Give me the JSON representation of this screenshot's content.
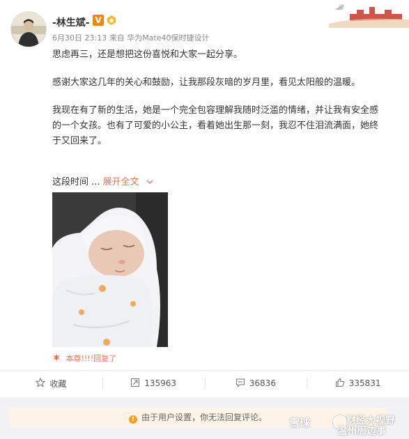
{
  "post": {
    "username": "-林生斌-",
    "vip_badge": "V",
    "timestamp": "6月30日 23:13",
    "source_prefix": "来自",
    "source": "华为Mate40保时捷设计",
    "paragraphs": [
      "思虑再三，还是想把这份喜悦和大家一起分享。",
      "感谢大家这几年的关心和鼓励，让我那段灰暗的岁月里，看见太阳般的温暖。",
      "我现在有了新的生活，她是一个完全包容理解我随时泛滥的情绪，并让我有安全感的一个女孩。也有了可爱的小公主，看着她出生那一刻，我忍不住泪流满面，她终于又回来了。"
    ],
    "truncated_text": "这段时间 ...",
    "expand_label": "展开全文",
    "reply_line": "本尊!!!!回复了"
  },
  "actions": {
    "favorite_label": "收藏",
    "repost_count": "135963",
    "comment_count": "36836",
    "like_count": "335831"
  },
  "notice": {
    "text": "由于用户设置，你无法回复评论。"
  },
  "watermarks": {
    "left": "雪球",
    "right_top": "财经大视野",
    "right_bottom": "温州周边事"
  },
  "colors": {
    "accent": "#eb7350",
    "vip": "#f2870c",
    "notice_bg": "#fdf3e6",
    "warning": "#f4a11f"
  },
  "icons": [
    "star-icon",
    "repost-icon",
    "comment-icon",
    "thumbs-up-icon",
    "warning-icon",
    "chevron-down-icon",
    "fan-badge-icon"
  ]
}
